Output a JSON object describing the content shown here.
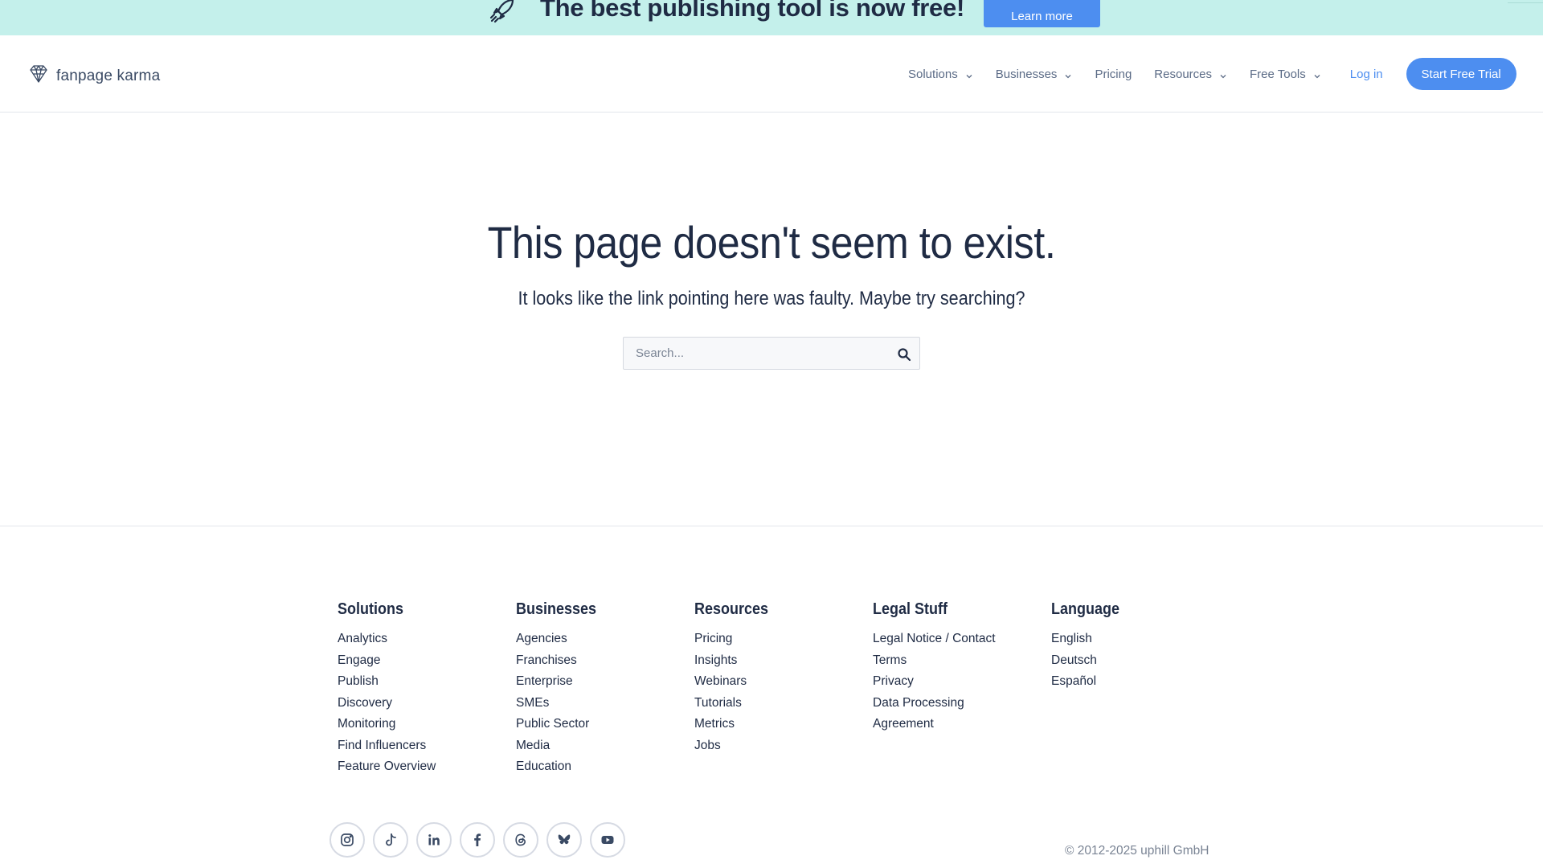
{
  "banner": {
    "icon": "rocket-icon",
    "text": "The best publishing tool is now free!",
    "button_label": "Learn more",
    "background_color": "#c4f0eb"
  },
  "header": {
    "logo_text": "fanpage karma",
    "nav": [
      {
        "label": "Solutions",
        "has_dropdown": true
      },
      {
        "label": "Businesses",
        "has_dropdown": true
      },
      {
        "label": "Pricing",
        "has_dropdown": false
      },
      {
        "label": "Resources",
        "has_dropdown": true
      },
      {
        "label": "Free Tools",
        "has_dropdown": true
      }
    ],
    "login_label": "Log in",
    "trial_label": "Start Free Trial",
    "accent_color": "#4d8ef0"
  },
  "main": {
    "title": "This page doesn't seem to exist.",
    "subtitle": "It looks like the link pointing here was faulty. Maybe try searching?",
    "search": {
      "placeholder": "Search...",
      "value": "",
      "button_icon": "search-icon"
    }
  },
  "footer": {
    "columns": [
      {
        "title": "Solutions",
        "links": [
          "Analytics",
          "Engage",
          "Publish",
          "Discovery",
          "Monitoring",
          "Find Influencers",
          "Feature Overview"
        ]
      },
      {
        "title": "Businesses",
        "links": [
          "Agencies",
          "Franchises",
          "Enterprise",
          "SMEs",
          "Public Sector",
          "Media",
          "Education"
        ]
      },
      {
        "title": "Resources",
        "links": [
          "Pricing",
          "Insights",
          "Webinars",
          "Tutorials",
          "Metrics",
          "Jobs"
        ]
      },
      {
        "title": "Legal Stuff",
        "links": [
          "Legal Notice / Contact",
          "Terms",
          "Privacy",
          "Data Processing",
          "Agreement"
        ]
      },
      {
        "title": "Language",
        "links": [
          "English",
          "Deutsch",
          "Español"
        ]
      }
    ],
    "socials": [
      "instagram-icon",
      "tiktok-icon",
      "linkedin-icon",
      "facebook-icon",
      "threads-icon",
      "bluesky-icon",
      "youtube-icon"
    ],
    "copyright": "© 2012-2025 uphill GmbH"
  }
}
